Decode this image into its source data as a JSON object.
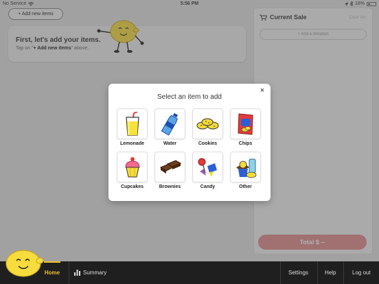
{
  "status_bar": {
    "carrier": "No Service",
    "time": "5:56 PM",
    "battery": "18%"
  },
  "main": {
    "add_new_label": "+ Add new items",
    "onboard_title": "First, let's add your items.",
    "onboard_sub_pre": "Tap on \"",
    "onboard_sub_bold": "+ Add new items",
    "onboard_sub_post": "\" above."
  },
  "sale": {
    "title": "Current Sale",
    "clear_label": "Clear list",
    "donation_label": "+ Add a donation",
    "total_label": "Total $ --"
  },
  "modal": {
    "title": "Select an item to add",
    "close": "×",
    "items": [
      {
        "label": "Lemonade",
        "icon": "lemonade-icon"
      },
      {
        "label": "Water",
        "icon": "water-bottle-icon"
      },
      {
        "label": "Cookies",
        "icon": "cookies-icon"
      },
      {
        "label": "Chips",
        "icon": "chips-icon"
      },
      {
        "label": "Cupcakes",
        "icon": "cupcake-icon"
      },
      {
        "label": "Brownies",
        "icon": "brownies-icon"
      },
      {
        "label": "Candy",
        "icon": "candy-icon"
      },
      {
        "label": "Other",
        "icon": "other-items-icon"
      }
    ]
  },
  "nav": {
    "home": "Home",
    "summary": "Summary",
    "settings": "Settings",
    "help": "Help",
    "logout": "Log out"
  },
  "colors": {
    "accent_yellow": "#f0c12b",
    "total_button": "#e38c8c",
    "nav_bg": "#1f1f1f"
  }
}
